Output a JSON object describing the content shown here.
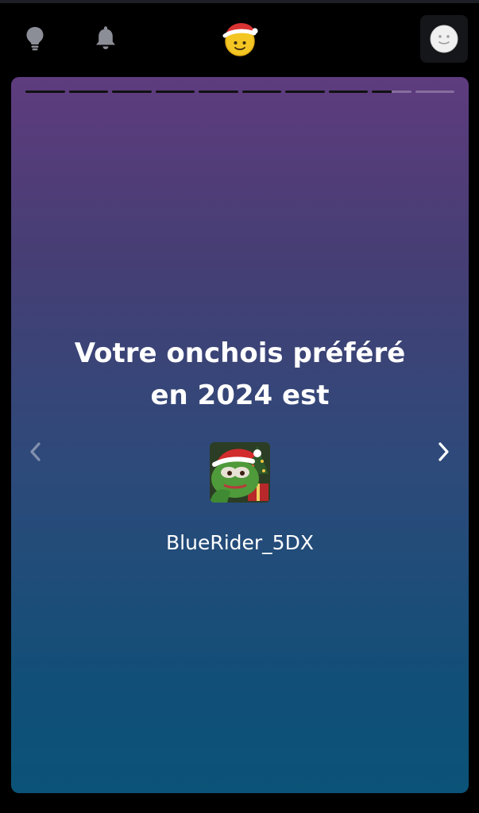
{
  "topbar": {
    "icons": [
      "lightbulb-icon",
      "bell-icon",
      "santa-smiley-logo",
      "profile-avatar"
    ]
  },
  "story": {
    "segments_total": 10,
    "segments_completed": 8,
    "current_segment_progress": 0.5,
    "headline_line1": "Votre onchois préféré",
    "headline_line2": "en 2024 est",
    "username": "BlueRider_5DX"
  },
  "colors": {
    "gradient_top": "#5e3c7e",
    "gradient_bottom": "#0b5378",
    "text": "#ffffff"
  }
}
